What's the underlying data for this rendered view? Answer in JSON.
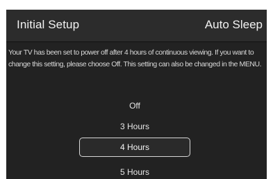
{
  "header": {
    "title": "Initial Setup",
    "page": "Auto Sleep"
  },
  "description": {
    "line1": "Your TV has been set to power off after 4 hours of continuous viewing. If you want to",
    "line2": "change this setting, please choose Off. This setting can also be changed in the MENU."
  },
  "options": [
    {
      "label": "Off",
      "selected": false
    },
    {
      "label": "3 Hours",
      "selected": false
    },
    {
      "label": "4 Hours",
      "selected": true
    },
    {
      "label": "5 Hours",
      "selected": false
    }
  ],
  "colors": {
    "background": "#222222",
    "header_background": "#2c2c2c",
    "text": "#e6e6e6",
    "selection_border": "#d8d8d8"
  }
}
